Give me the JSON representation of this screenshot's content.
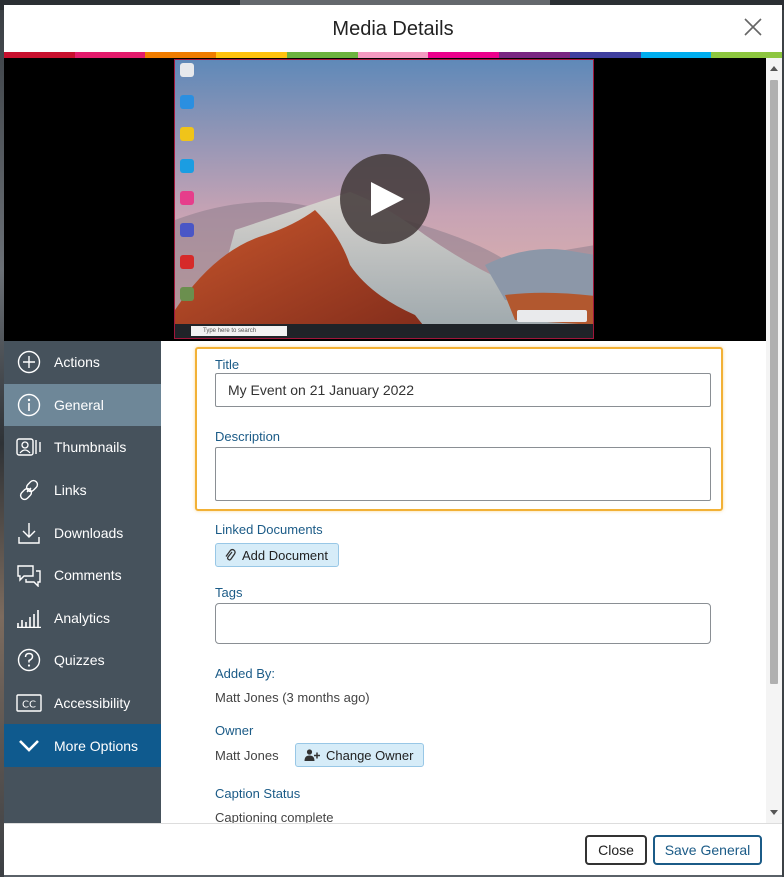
{
  "modal": {
    "title": "Media Details"
  },
  "stripe_colors": [
    "#c8102e",
    "#e31b6c",
    "#f07d00",
    "#ffc20e",
    "#6cb33f",
    "#f49ac1",
    "#ec008c",
    "#7a2582",
    "#3f3f9f",
    "#00aeef",
    "#8dc63f"
  ],
  "sidebar": {
    "items": [
      {
        "label": "Actions",
        "icon": "plus-circle-icon"
      },
      {
        "label": "General",
        "icon": "info-circle-icon",
        "active": true
      },
      {
        "label": "Thumbnails",
        "icon": "thumbnails-icon"
      },
      {
        "label": "Links",
        "icon": "link-icon"
      },
      {
        "label": "Downloads",
        "icon": "download-icon"
      },
      {
        "label": "Comments",
        "icon": "comments-icon"
      },
      {
        "label": "Analytics",
        "icon": "analytics-icon"
      },
      {
        "label": "Quizzes",
        "icon": "question-circle-icon"
      },
      {
        "label": "Accessibility",
        "icon": "closed-captions-icon"
      },
      {
        "label": "More Options",
        "icon": "chevron-down-icon"
      }
    ]
  },
  "player": {
    "taskbar_search": "Type here to search"
  },
  "general": {
    "title_label": "Title",
    "title_value": "My Event on 21 January 2022",
    "description_label": "Description",
    "description_value": "",
    "linked_docs_label": "Linked Documents",
    "add_document_label": "Add Document",
    "tags_label": "Tags",
    "added_by_label": "Added By:",
    "added_by_value": "Matt Jones (3 months ago)",
    "owner_label": "Owner",
    "owner_value": "Matt Jones",
    "change_owner_label": "Change Owner",
    "caption_status_label": "Caption Status",
    "caption_status_value": "Captioning complete"
  },
  "footer": {
    "close_label": "Close",
    "save_label": "Save General"
  },
  "colors": {
    "sidebar_bg": "#46525c",
    "sidebar_active": "#6e8798",
    "more_options": "#0f5a8e",
    "label_blue": "#1b5b87",
    "highlight": "#f2b136"
  }
}
